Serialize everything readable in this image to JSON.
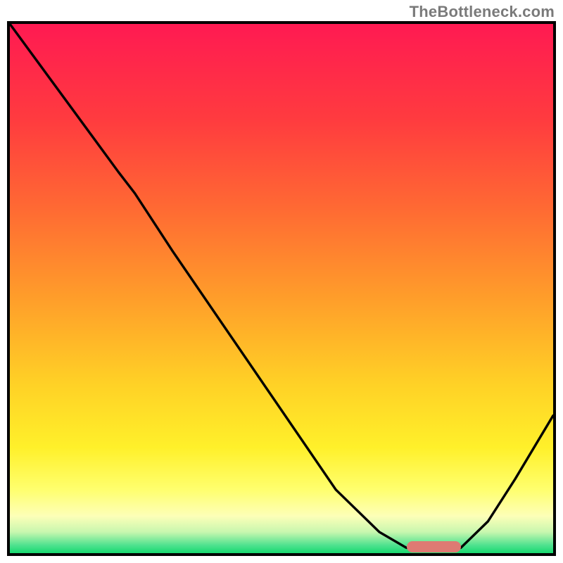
{
  "watermark": "TheBottleneck.com",
  "chart_data": {
    "type": "line",
    "title": "",
    "xlabel": "",
    "ylabel": "",
    "xlim": [
      0,
      100
    ],
    "ylim": [
      0,
      100
    ],
    "grid": false,
    "legend": false,
    "marker": {
      "x_start": 73,
      "x_end": 83,
      "y": 1.2,
      "color": "#de7a73"
    },
    "series": [
      {
        "name": "curve",
        "color": "#000000",
        "x": [
          0,
          5,
          10,
          15,
          20,
          23,
          30,
          40,
          50,
          60,
          68,
          73,
          78,
          83,
          88,
          93,
          100
        ],
        "y": [
          100,
          93,
          86,
          79,
          72,
          68,
          57,
          42,
          27,
          12,
          4,
          1,
          1,
          1,
          6,
          14,
          26
        ]
      }
    ],
    "background_gradient": {
      "stops": [
        {
          "offset": 0.0,
          "color": "#ff1a52"
        },
        {
          "offset": 0.18,
          "color": "#ff3b3f"
        },
        {
          "offset": 0.35,
          "color": "#ff6a33"
        },
        {
          "offset": 0.52,
          "color": "#ff9e2a"
        },
        {
          "offset": 0.68,
          "color": "#ffd126"
        },
        {
          "offset": 0.8,
          "color": "#fff02a"
        },
        {
          "offset": 0.88,
          "color": "#ffff6e"
        },
        {
          "offset": 0.93,
          "color": "#fdffb8"
        },
        {
          "offset": 0.96,
          "color": "#c8f7af"
        },
        {
          "offset": 0.985,
          "color": "#4fe28f"
        },
        {
          "offset": 1.0,
          "color": "#17d96f"
        }
      ]
    }
  }
}
